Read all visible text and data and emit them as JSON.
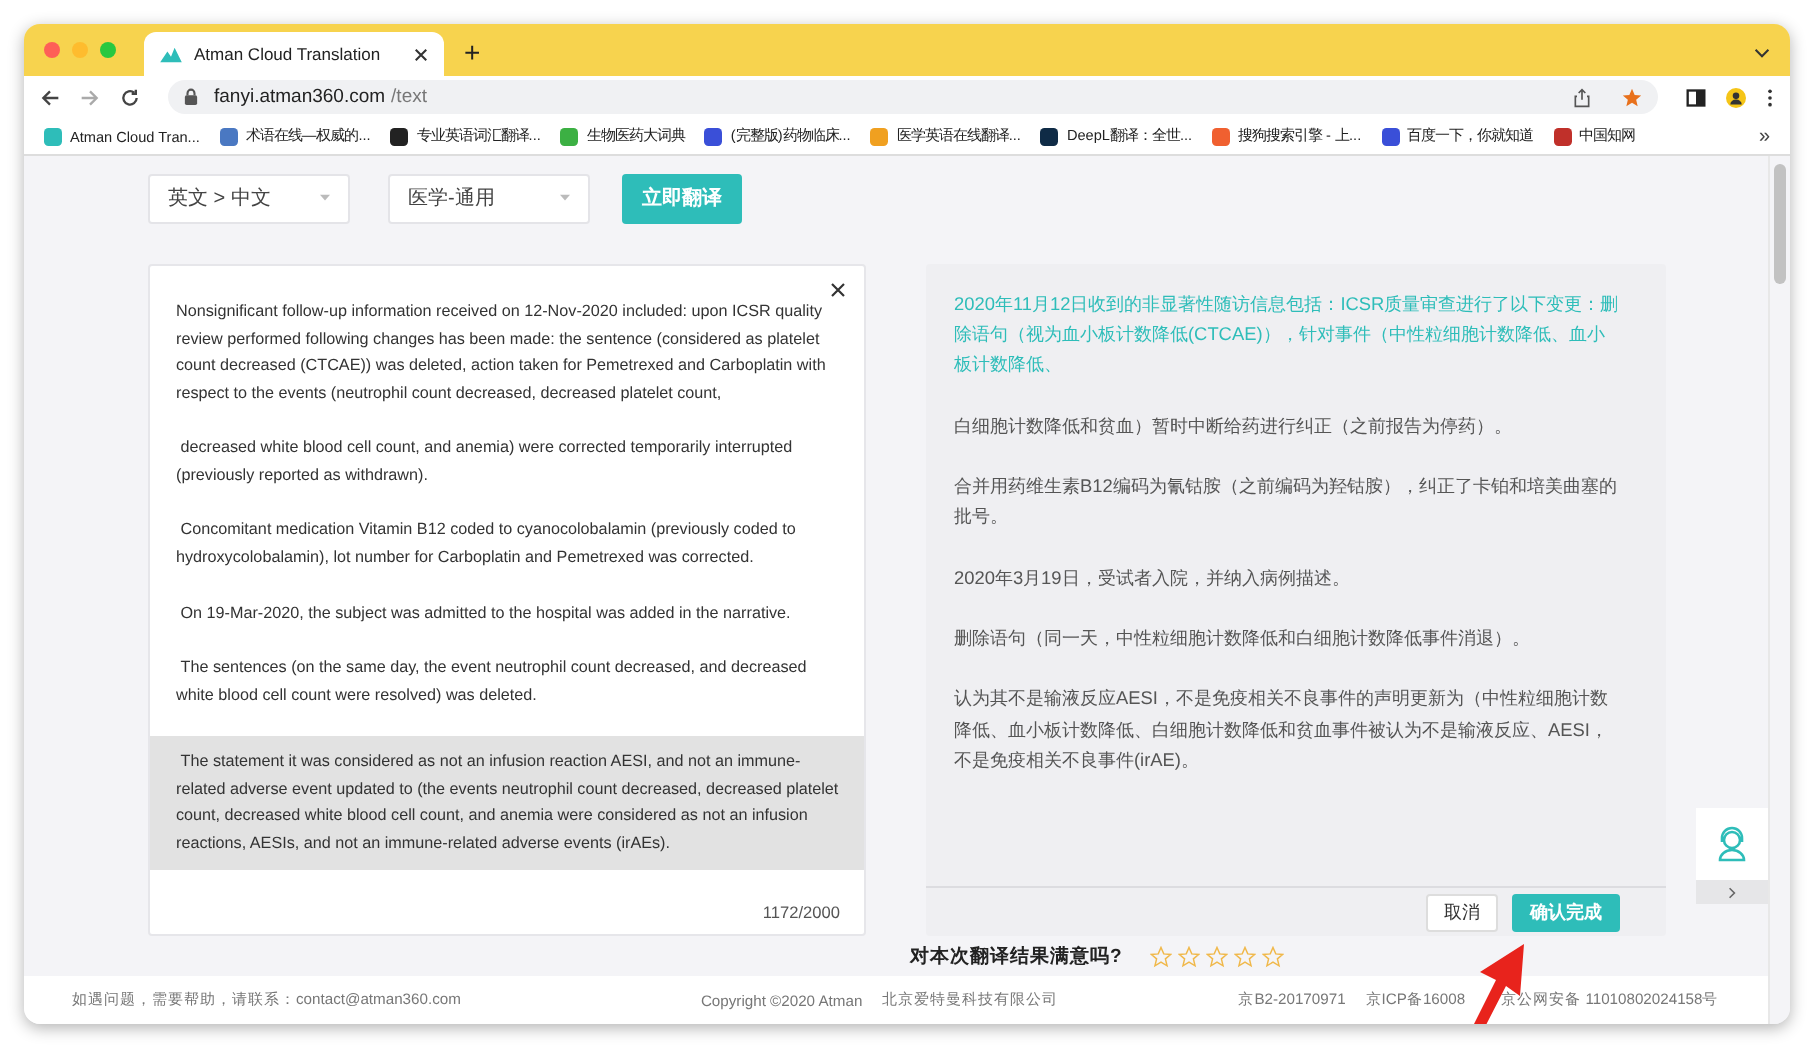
{
  "browser": {
    "tab_title": "Atman Cloud Translation",
    "new_tab": "+",
    "url_host": "fanyi.atman360.com",
    "url_path": "/text",
    "bookmarks": [
      {
        "label": "Atman Cloud Tran...",
        "color": "#2ebdb9"
      },
      {
        "label": "术语在线—权威的...",
        "color": "#4a78c2"
      },
      {
        "label": "专业英语词汇翻译...",
        "color": "#222222"
      },
      {
        "label": "生物医药大词典",
        "color": "#3cb043"
      },
      {
        "label": "(完整版)药物临床...",
        "color": "#3a4fd8"
      },
      {
        "label": "医学英语在线翻译...",
        "color": "#f0a020"
      },
      {
        "label": "DeepL翻译：全世...",
        "color": "#0f2b46"
      },
      {
        "label": "搜狗搜索引擎 - 上...",
        "color": "#f06030"
      },
      {
        "label": "百度一下，你就知道",
        "color": "#3a4fd8"
      },
      {
        "label": "中国知网",
        "color": "#c0302a"
      }
    ],
    "more": "»"
  },
  "toolbar": {
    "language": "英文 > 中文",
    "domain": "医学-通用",
    "translate": "立即翻译"
  },
  "source": {
    "paragraphs": [
      {
        "text": "Nonsignificant follow-up information received on 12-Nov-2020 included: upon ICSR quality review performed following changes has been made: the sentence (considered as platelet count decreased (CTCAE)) was deleted, action taken for Pemetrexed and Carboplatin with respect to the events (neutrophil count decreased, decreased platelet count,",
        "highlighted": false
      },
      {
        "text": " decreased white blood cell count, and anemia) were corrected temporarily interrupted (previously reported as withdrawn).",
        "highlighted": false
      },
      {
        "text": " Concomitant medication Vitamin B12 coded to cyanocolobalamin (previously coded to hydroxycolobalamin), lot number for Carboplatin and Pemetrexed was corrected.",
        "highlighted": false
      },
      {
        "text": " On 19-Mar-2020, the subject was admitted to the hospital was added in the narrative.",
        "highlighted": false
      },
      {
        "text": " The sentences (on the same day, the event neutrophil count decreased, and decreased white blood cell count were resolved) was deleted.",
        "highlighted": false
      },
      {
        "text": " The statement it was considered as not an infusion reaction AESI, and not an immune-related adverse event updated to (the events neutrophil count decreased, decreased platelet count, decreased white blood cell count, and anemia were considered as not an infusion reactions, AESIs, and not an immune-related adverse events (irAEs).",
        "highlighted": true
      }
    ],
    "counter": "1172/2000"
  },
  "target": {
    "paragraphs": [
      {
        "text": "2020年11月12日收到的非显著性随访信息包括：ICSR质量审查进行了以下变更：删除语句（视为血小板计数降低(CTCAE)），针对事件（中性粒细胞计数降低、血小板计数降低、",
        "highlighted": true
      },
      {
        "text": "白细胞计数降低和贫血）暂时中断给药进行纠正（之前报告为停药）。",
        "highlighted": false
      },
      {
        "text": "合并用药维生素B12编码为氰钴胺（之前编码为羟钴胺），纠正了卡铂和培美曲塞的批号。",
        "highlighted": false
      },
      {
        "text": "2020年3月19日，受试者入院，并纳入病例描述。",
        "highlighted": false
      },
      {
        "text": "删除语句（同一天，中性粒细胞计数降低和白细胞计数降低事件消退）。",
        "highlighted": false
      },
      {
        "text": "认为其不是输液反应AESI，不是免疫相关不良事件的声明更新为（中性粒细胞计数降低、血小板计数降低、白细胞计数降低和贫血事件被认为不是输液反应、AESI，不是免疫相关不良事件(irAE)。",
        "highlighted": false
      }
    ],
    "cancel": "取消",
    "confirm": "确认完成"
  },
  "rating": {
    "question": "对本次翻译结果满意吗?",
    "stars": 0
  },
  "footer": {
    "contact": "如遇问题，需要帮助，请联系：contact@atman360.com",
    "copyright": "Copyright ©2020 Atman",
    "company": "北京爱特曼科技有限公司",
    "license": "京B2-20170971",
    "icp": "京ICP备16008",
    "police": "京公网安备 11010802024158号"
  }
}
